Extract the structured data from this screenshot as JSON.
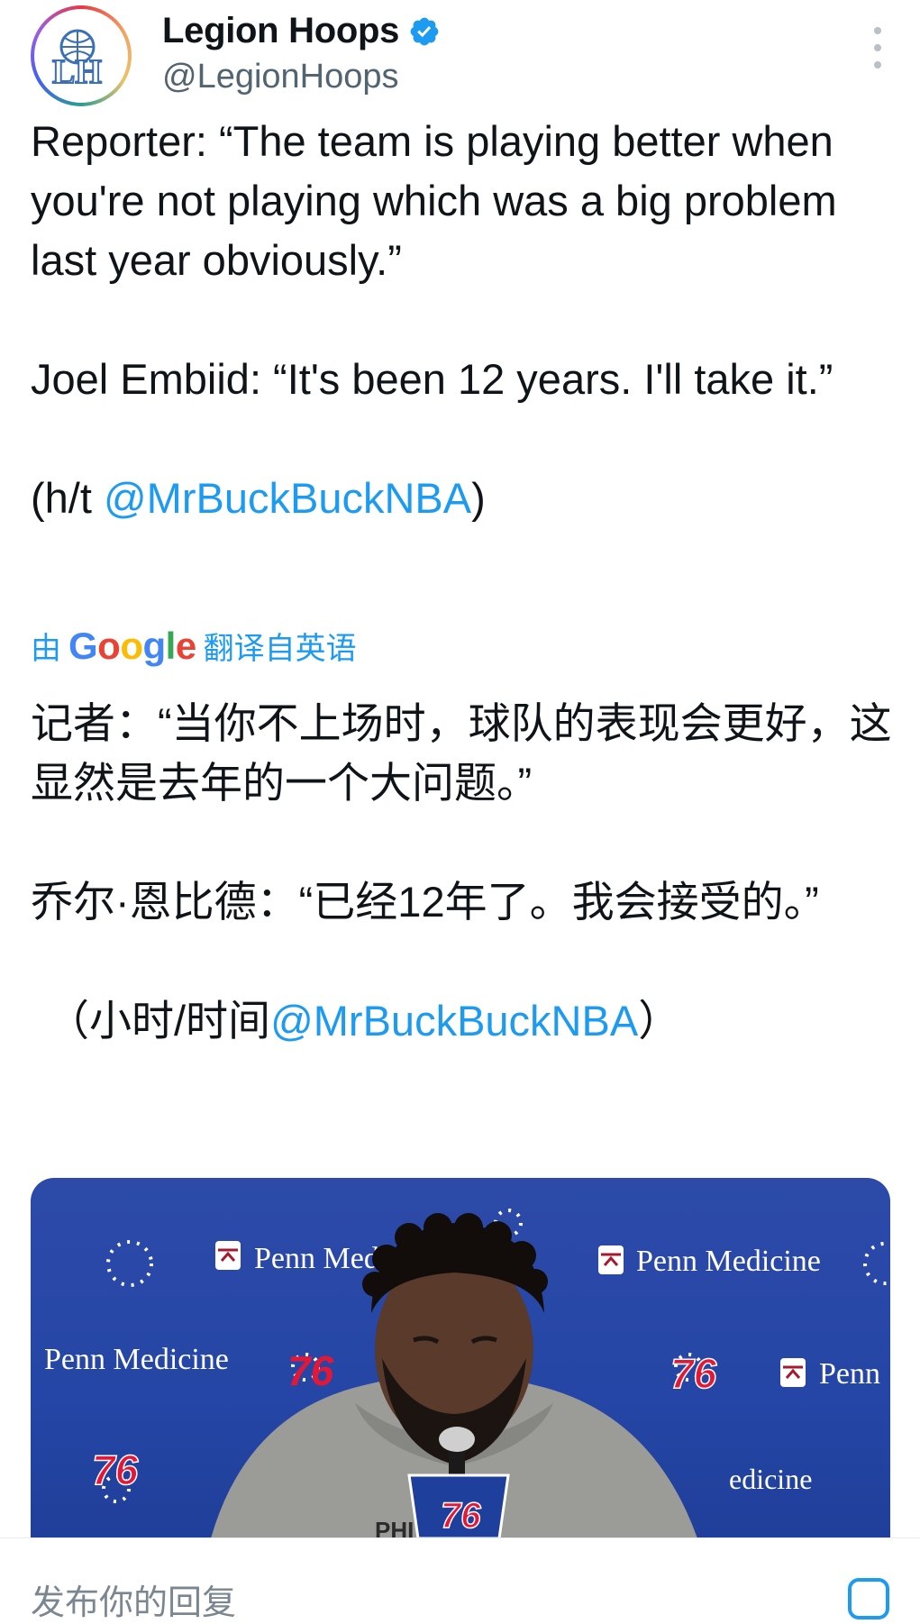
{
  "author": {
    "display_name": "Legion Hoops",
    "handle": "@LegionHoops",
    "avatar_initials": "LH"
  },
  "tweet": {
    "line1": "Reporter: “The team is playing better when you're not playing which was a big problem last year obviously.”",
    "line2": "Joel Embiid: “It's been 12 years. I'll take it.”",
    "ht_prefix": "(h/t ",
    "ht_mention": "@MrBuckBuckNBA",
    "ht_suffix": ")"
  },
  "translation": {
    "by": "由",
    "google": "Google",
    "from": "翻译自英语",
    "line1": "记者：“当你不上场时，球队的表现会更好，这显然是去年的一个大问题。”",
    "line2": "乔尔·恩比德：“已经12年了。我会接受的。”",
    "ht_prefix": "（小时/时间",
    "ht_mention": "@MrBuckBuckNBA",
    "ht_suffix": "）"
  },
  "media": {
    "sponsor_1": "Penn Medicine",
    "sponsor_2": "Penn Medicine",
    "sponsor_3": "Penn Medicine",
    "sponsor_4": "Penn",
    "team_logo_1": "76",
    "team_logo_2": "76",
    "team_logo_3": "76",
    "team_logo_4": "76"
  },
  "reply_bar": {
    "placeholder": "发布你的回复"
  },
  "colors": {
    "accent": "#1d9bf0",
    "text": "#0f1419",
    "muted": "#536471",
    "backdrop": "#2546a6",
    "logo_red": "#e31837"
  },
  "icons": {
    "verified": "verified-badge-icon",
    "more": "more-options-icon",
    "camera": "camera-icon"
  }
}
